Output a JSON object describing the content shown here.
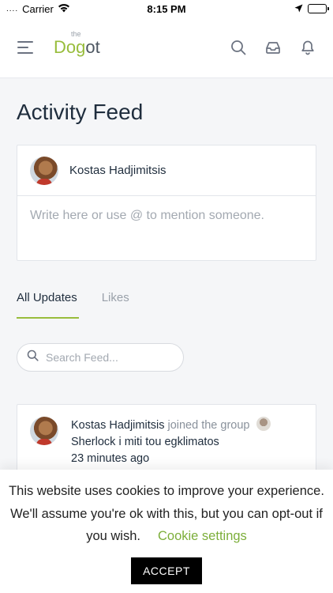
{
  "status_bar": {
    "signal_dots": "....",
    "carrier": "Carrier",
    "time": "8:15 PM"
  },
  "header": {
    "logo_small": "the",
    "logo_main": "Dog",
    "logo_tail": "ot",
    "icons": [
      "menu-icon",
      "search-icon",
      "inbox-icon",
      "bell-icon"
    ]
  },
  "page": {
    "title": "Activity Feed"
  },
  "composer": {
    "user_name": "Kostas Hadjimitsis",
    "placeholder": "Write here or use @ to mention someone."
  },
  "tabs": [
    {
      "label": "All Updates",
      "active": true
    },
    {
      "label": "Likes",
      "active": false
    }
  ],
  "search": {
    "placeholder": "Search Feed..."
  },
  "feed": {
    "items": [
      {
        "user": "Kostas Hadjimitsis",
        "action": "joined the group",
        "group": "Sherlock i miti tou egklimatos",
        "time": "23 minutes ago"
      }
    ]
  },
  "cookie": {
    "text": "This website uses cookies to improve your experience. We'll assume you're ok with this, but you can opt-out if you wish.",
    "settings_link": "Cookie settings",
    "accept_label": "ACCEPT"
  },
  "colors": {
    "accent": "#98bd3c",
    "link": "#7cae3a",
    "text": "#1f2d3d",
    "muted": "#9aa1aa"
  }
}
